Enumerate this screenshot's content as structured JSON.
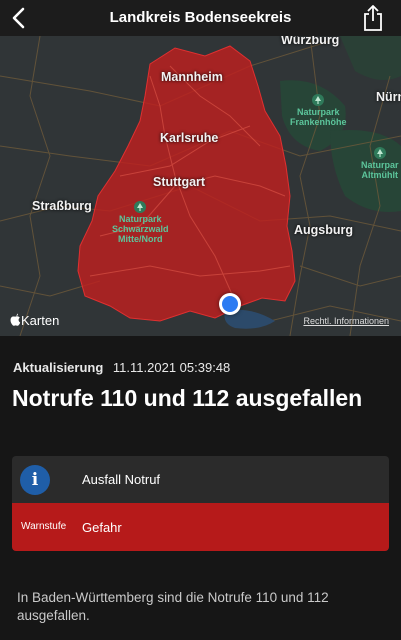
{
  "nav": {
    "title": "Landkreis Bodenseekreis",
    "back_icon": "chevron-left-icon",
    "share_icon": "share-icon"
  },
  "map": {
    "cities": {
      "wuerzburg": "Würzburg",
      "mannheim": "Mannheim",
      "nuernberg": "Nürn",
      "karlsruhe": "Karlsruhe",
      "stuttgart": "Stuttgart",
      "strassburg": "Straßburg",
      "augsburg": "Augsburg"
    },
    "parks": {
      "frankenhoehe": [
        "Naturpark",
        "Frankenhöhe"
      ],
      "schwarzwald": [
        "Naturpark",
        "Schwarzwald",
        "Mitte/Nord"
      ],
      "altmuehl": [
        "Naturpar",
        "Altmühlt"
      ]
    },
    "brand": "Karten",
    "legal": "Rechtl. Informationen",
    "region_color": "#c0201f"
  },
  "update": {
    "label": "Aktualisierung",
    "value": "11.11.2021 05:39:48"
  },
  "headline": "Notrufe 110 und 112 ausgefallen",
  "info_card": {
    "icon": "info-icon",
    "icon_glyph": "i",
    "text": "Ausfall Notruf"
  },
  "warn_card": {
    "label": "Warnstufe",
    "value": "Gefahr",
    "color": "#b61a1a"
  },
  "description": "In Baden-Württemberg sind die Notrufe 110 und 112 ausgefallen."
}
